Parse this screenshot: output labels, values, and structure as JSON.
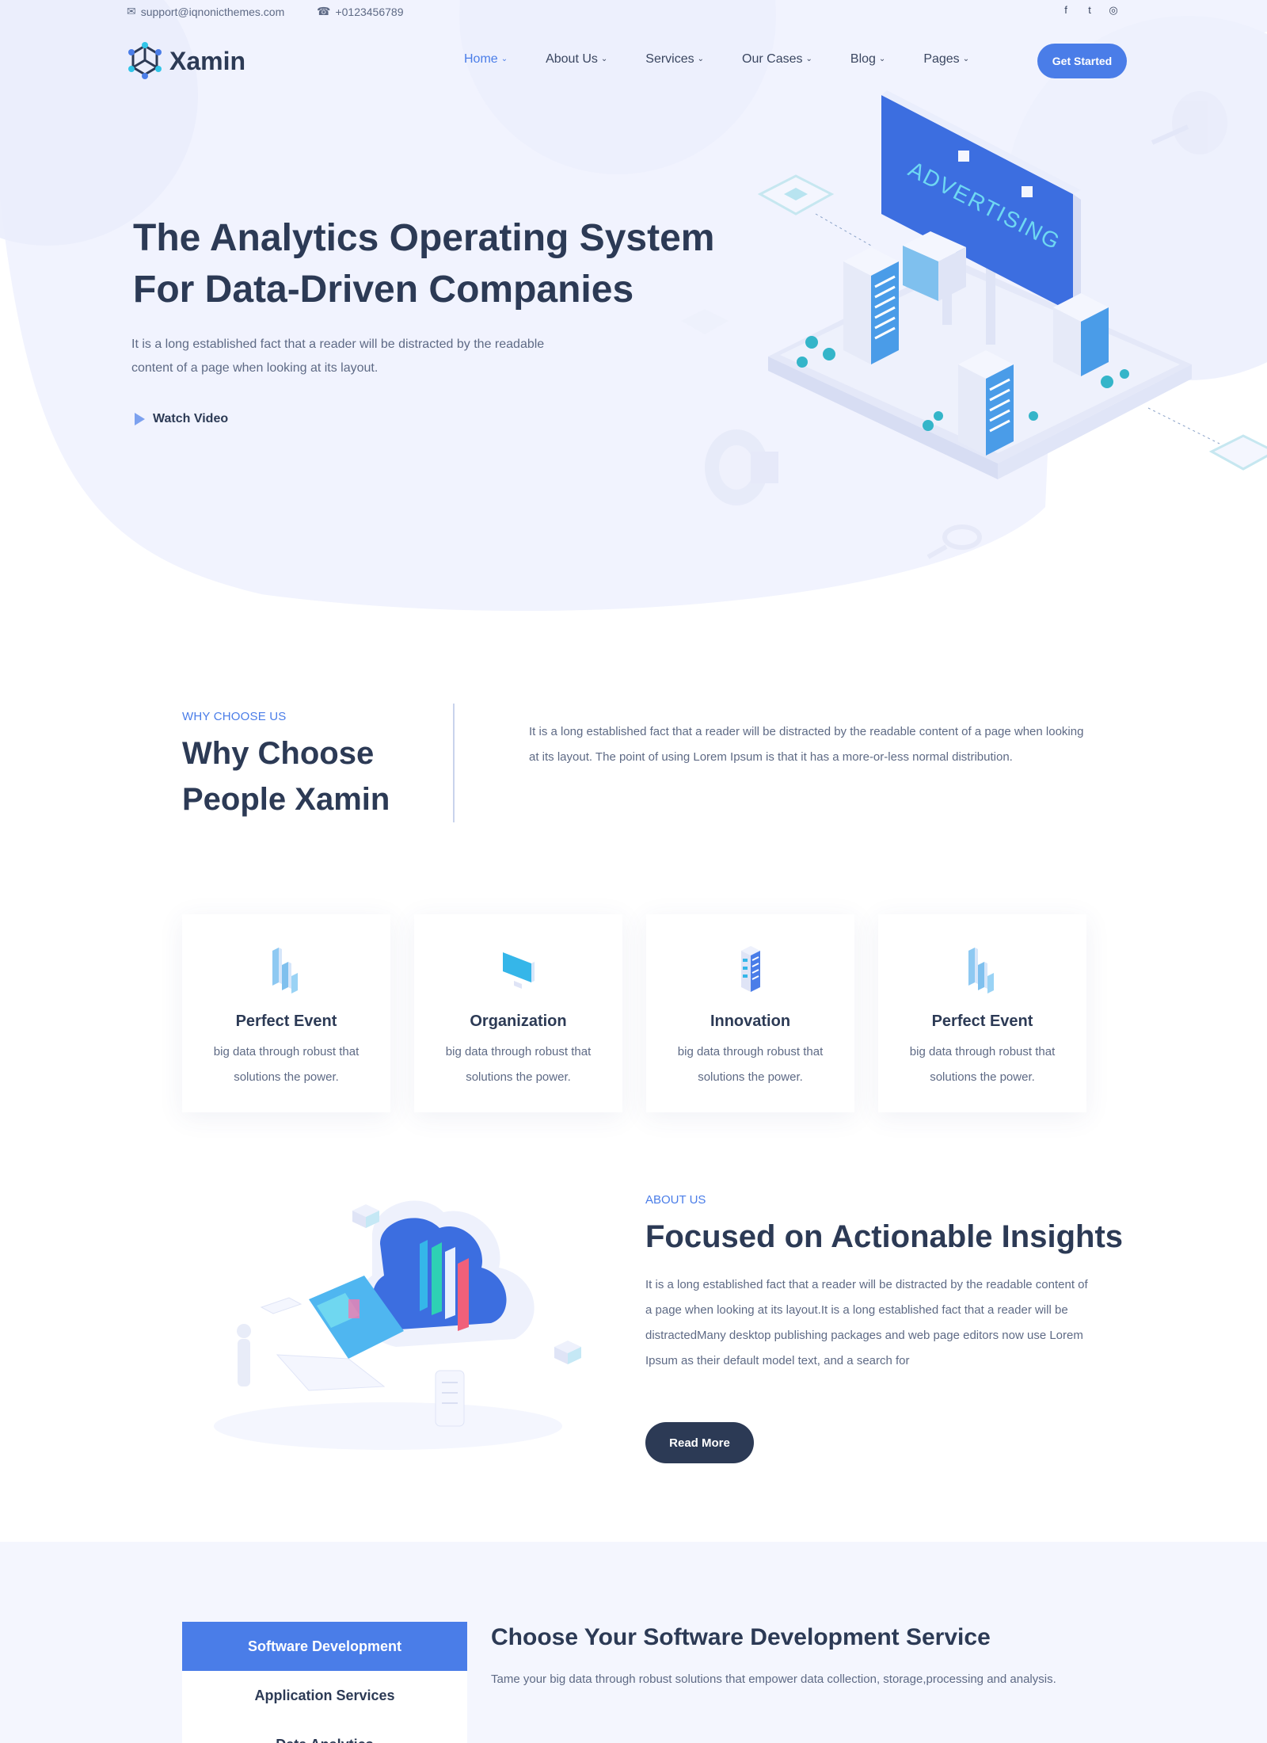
{
  "topbar": {
    "email": "support@iqnonicthemes.com",
    "phone": "+0123456789",
    "social": [
      {
        "name": "facebook-icon",
        "glyph": "f"
      },
      {
        "name": "twitter-icon",
        "glyph": "t"
      },
      {
        "name": "instagram-icon",
        "glyph": "◎"
      }
    ]
  },
  "brand": {
    "name": "Xamin"
  },
  "nav": {
    "items": [
      "Home",
      "About Us",
      "Services",
      "Our Cases",
      "Blog",
      "Pages"
    ],
    "cta": "Get Started"
  },
  "hero": {
    "title": "The Analytics Operating System For Data-Driven Companies",
    "description": "It is a long established fact that a reader will be distracted by the readable content of a page when looking at its layout.",
    "watch_video": "Watch Video",
    "billboard_text": "ADVERTISING"
  },
  "why": {
    "subtitle": "WHY CHOOSE US",
    "title": "Why Choose People Xamin",
    "description": "It is a long established fact that a reader will be distracted by the readable content of a page when looking at its layout. The point of using Lorem Ipsum is that it has a more-or-less normal distribution."
  },
  "features": [
    {
      "title": "Perfect Event",
      "description": "big data through robust that solutions the power."
    },
    {
      "title": "Organization",
      "description": "big data through robust that solutions the power."
    },
    {
      "title": "Innovation",
      "description": "big data through robust that solutions the power."
    },
    {
      "title": "Perfect Event",
      "description": "big data through robust that solutions the power."
    }
  ],
  "about": {
    "subtitle": "ABOUT US",
    "title": "Focused on Actionable Insights",
    "description": "It is a long established fact that a reader will be distracted by the readable content of a page when looking at its layout.It is a long established fact that a reader will be distractedMany desktop publishing packages and web page editors now use Lorem Ipsum as their default model text, and a search for",
    "button": "Read More"
  },
  "services": {
    "tabs": [
      "Software Development",
      "Application Services",
      "Data Analytics"
    ],
    "title": "Choose Your Software Development Service",
    "description": "Tame your big data through robust solutions that empower data collection, storage,processing and analysis."
  },
  "colors": {
    "accent": "#4a7de8",
    "heading": "#2c3a55",
    "body_text": "#5e6a85",
    "hero_bg": "#f1f3fe"
  }
}
